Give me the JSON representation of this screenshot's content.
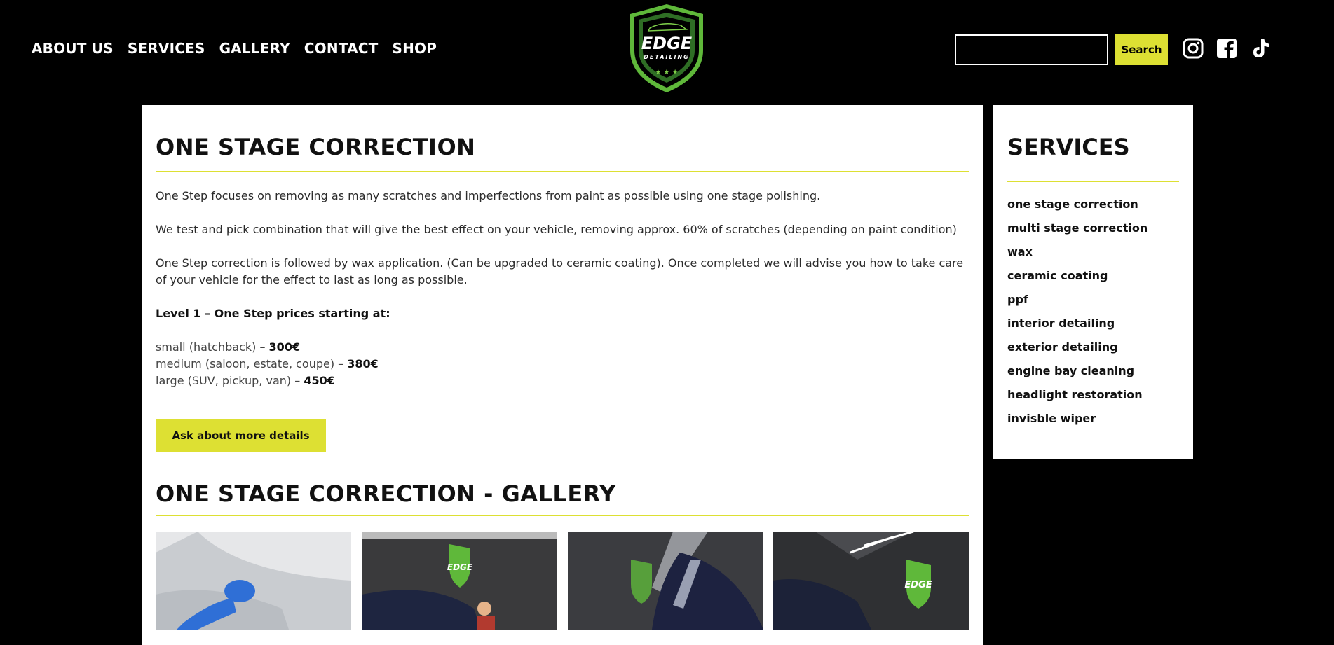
{
  "nav": {
    "items": [
      {
        "label": "ABOUT US"
      },
      {
        "label": "SERVICES"
      },
      {
        "label": "GALLERY"
      },
      {
        "label": "CONTACT"
      },
      {
        "label": "SHOP"
      }
    ]
  },
  "logo": {
    "line1": "EDGE",
    "line2": "DETAILING"
  },
  "search": {
    "placeholder": "",
    "button_label": "Search"
  },
  "socials": [
    "instagram-icon",
    "facebook-icon",
    "tiktok-icon"
  ],
  "main": {
    "title": "ONE STAGE CORRECTION",
    "paragraphs": [
      "One Step focuses on removing as many scratches and imperfections from paint as possible using one stage polishing.",
      "We test and pick combination that will give the best effect on your vehicle, removing approx. 60% of scratches (depending on paint condition)",
      "One Step correction is followed by wax application. (Can be upgraded to ceramic coating). Once completed we will advise you how to take care of your vehicle for the effect to last as long as possible."
    ],
    "price_title": "Level 1 – One Step prices starting at:",
    "prices": [
      {
        "label": "small (hatchback) – ",
        "value": "300€"
      },
      {
        "label": "medium (saloon, estate, coupe) – ",
        "value": "380€"
      },
      {
        "label": "large (SUV, pickup, van) – ",
        "value": "450€"
      }
    ],
    "cta_label": "Ask about more details",
    "gallery_title": "ONE STAGE CORRECTION - GALLERY"
  },
  "sidebar": {
    "title": "SERVICES",
    "items": [
      "one stage correction",
      "multi stage correction",
      "wax",
      "ceramic coating",
      "ppf",
      "interior detailing",
      "exterior detailing",
      "engine bay cleaning",
      "headlight restoration",
      "invisble wiper"
    ]
  },
  "colors": {
    "accent": "#dde033",
    "background": "#000000",
    "logo_green": "#5fb83a"
  }
}
